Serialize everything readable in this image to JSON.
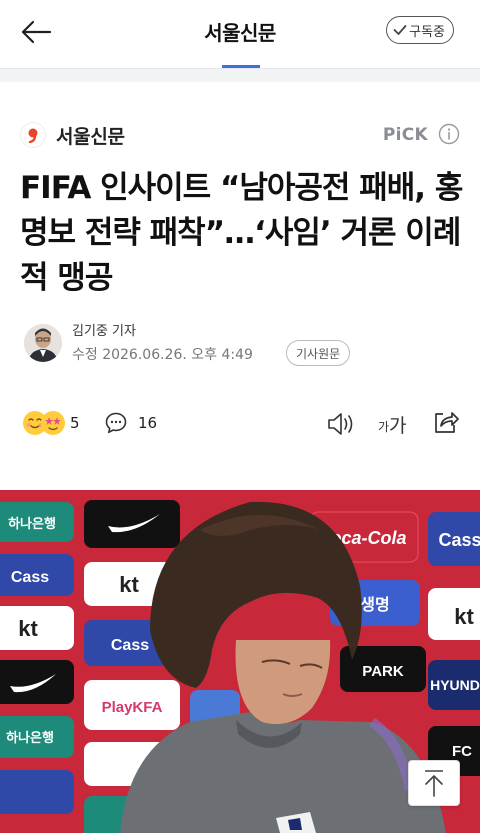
{
  "topbar": {
    "title": "서울신문",
    "subscribe_label": "구독중"
  },
  "article": {
    "press_name": "서울신문",
    "pick_label": "PiCK",
    "headline": "FIFA 인사이트 “남아공전 패배, 홍명보 전략 패착”…‘사임’ 거론 이례적 맹공",
    "reporter": "김기중 기자",
    "date": "수정 2026.06.26. 오후 4:49",
    "original_label": "기사원문"
  },
  "actions": {
    "reaction_count": "5",
    "comment_count": "16",
    "font_small": "가",
    "font_big": "가"
  },
  "photo": {
    "sponsor_texts": [
      "하나은행",
      "kt",
      "Cass",
      "PlayKFA",
      "Coca-Cola",
      "생명",
      "PARK",
      "HYUNDAI",
      "FC"
    ]
  },
  "colors": {
    "accent": "#3d6fdc",
    "press_logo": "#e8452c",
    "backdrop_red": "#c8283a"
  }
}
